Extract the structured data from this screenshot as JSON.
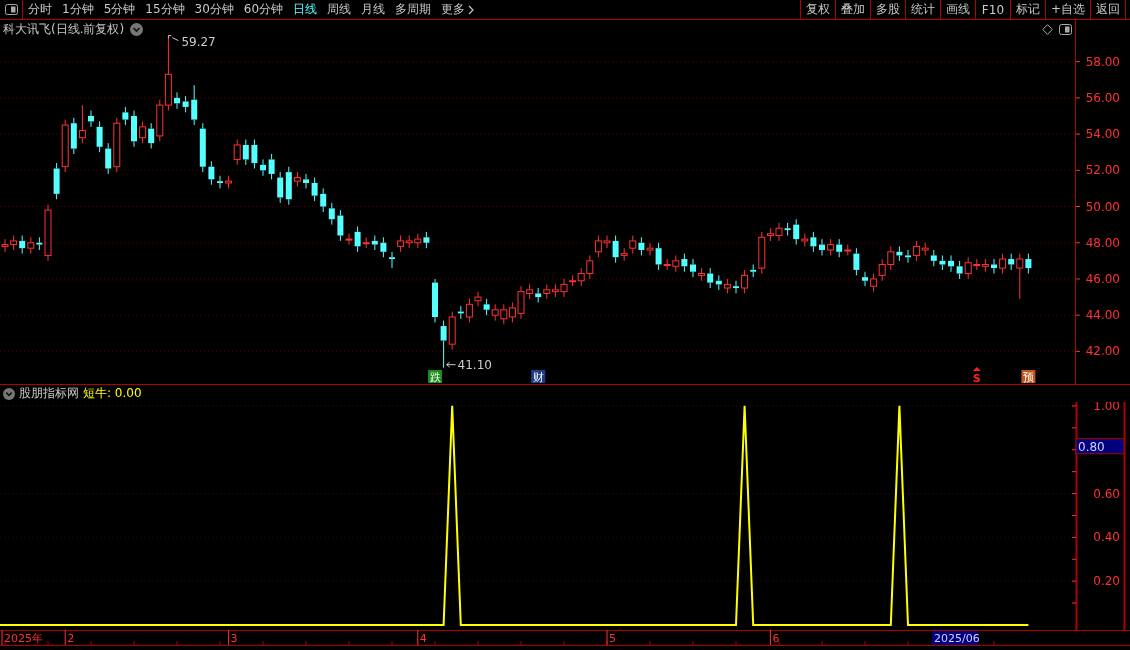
{
  "toolbar": {
    "periods": [
      {
        "label": "分时",
        "selected": false
      },
      {
        "label": "1分钟",
        "selected": false
      },
      {
        "label": "5分钟",
        "selected": false
      },
      {
        "label": "15分钟",
        "selected": false
      },
      {
        "label": "30分钟",
        "selected": false
      },
      {
        "label": "60分钟",
        "selected": false
      },
      {
        "label": "日线",
        "selected": true
      },
      {
        "label": "周线",
        "selected": false
      },
      {
        "label": "月线",
        "selected": false
      },
      {
        "label": "多周期",
        "selected": false
      }
    ],
    "more": "更多",
    "actions": [
      "复权",
      "叠加",
      "多股",
      "统计",
      "画线",
      "F10",
      "标记",
      "+自选",
      "返回"
    ]
  },
  "chart": {
    "title": "科大讯飞(日线.前复权)",
    "chart_data": {
      "type": "candlestick",
      "grid": true,
      "ylim": [
        40.2,
        60.3
      ],
      "yticks": [
        {
          "value": 42,
          "label": "42.00"
        },
        {
          "value": 44,
          "label": "44.00"
        },
        {
          "value": 46,
          "label": "46.00"
        },
        {
          "value": 48,
          "label": "48.00"
        },
        {
          "value": 50,
          "label": "50.00"
        },
        {
          "value": 52,
          "label": "52.00"
        },
        {
          "value": 54,
          "label": "54.00"
        },
        {
          "value": 56,
          "label": "56.00"
        },
        {
          "value": 58,
          "label": "58.00"
        }
      ],
      "ohlc": [
        [
          47.8,
          48.2,
          47.5,
          47.9
        ],
        [
          47.9,
          48.4,
          47.6,
          48.1
        ],
        [
          48.1,
          48.4,
          47.4,
          47.7
        ],
        [
          47.7,
          48.3,
          47.4,
          48.0
        ],
        [
          48.0,
          48.3,
          47.6,
          47.9
        ],
        [
          47.3,
          50.1,
          47.0,
          49.8
        ],
        [
          52.1,
          52.4,
          50.4,
          50.7
        ],
        [
          52.2,
          54.8,
          51.9,
          54.5
        ],
        [
          54.6,
          54.9,
          52.9,
          53.2
        ],
        [
          53.8,
          55.6,
          53.5,
          54.2
        ],
        [
          55.0,
          55.3,
          54.4,
          54.7
        ],
        [
          54.4,
          54.7,
          53.0,
          53.3
        ],
        [
          53.2,
          53.5,
          51.8,
          52.1
        ],
        [
          52.2,
          54.9,
          51.9,
          54.6
        ],
        [
          55.2,
          55.5,
          54.5,
          54.8
        ],
        [
          55.0,
          55.3,
          53.3,
          53.6
        ],
        [
          53.8,
          54.7,
          53.5,
          54.4
        ],
        [
          54.3,
          54.6,
          53.2,
          53.5
        ],
        [
          53.9,
          55.9,
          53.6,
          55.6
        ],
        [
          55.6,
          59.27,
          55.3,
          57.3
        ],
        [
          56.0,
          56.3,
          55.4,
          55.7
        ],
        [
          55.8,
          56.1,
          55.2,
          55.5
        ],
        [
          55.9,
          56.7,
          54.5,
          54.8
        ],
        [
          54.3,
          54.6,
          51.9,
          52.2
        ],
        [
          52.2,
          52.5,
          51.2,
          51.5
        ],
        [
          51.4,
          51.7,
          51.0,
          51.3
        ],
        [
          51.3,
          51.7,
          51.0,
          51.4
        ],
        [
          52.6,
          53.7,
          52.3,
          53.4
        ],
        [
          53.4,
          53.7,
          52.3,
          52.6
        ],
        [
          53.4,
          53.7,
          52.1,
          52.4
        ],
        [
          52.3,
          52.6,
          51.7,
          52.0
        ],
        [
          52.6,
          52.9,
          51.5,
          51.8
        ],
        [
          51.6,
          51.9,
          50.2,
          50.5
        ],
        [
          51.9,
          52.2,
          50.1,
          50.4
        ],
        [
          51.4,
          51.9,
          51.1,
          51.6
        ],
        [
          51.5,
          51.8,
          51.0,
          51.3
        ],
        [
          51.3,
          51.6,
          50.3,
          50.6
        ],
        [
          50.7,
          51.0,
          49.7,
          50.0
        ],
        [
          49.9,
          50.2,
          49.0,
          49.3
        ],
        [
          49.5,
          49.8,
          48.1,
          48.4
        ],
        [
          48.2,
          48.5,
          47.9,
          48.2
        ],
        [
          48.6,
          48.9,
          47.5,
          47.8
        ],
        [
          48.0,
          48.3,
          47.7,
          48.0
        ],
        [
          48.1,
          48.4,
          47.6,
          47.9
        ],
        [
          48.0,
          48.3,
          47.2,
          47.5
        ],
        [
          47.2,
          47.5,
          46.6,
          47.1
        ],
        [
          47.8,
          48.4,
          47.5,
          48.1
        ],
        [
          48.0,
          48.4,
          47.7,
          48.1
        ],
        [
          48.0,
          48.5,
          47.7,
          48.2
        ],
        [
          48.3,
          48.6,
          47.7,
          48.0
        ],
        [
          45.8,
          46.0,
          43.6,
          43.9
        ],
        [
          43.4,
          43.7,
          41.1,
          42.6
        ],
        [
          42.4,
          44.2,
          42.1,
          43.9
        ],
        [
          44.2,
          44.5,
          43.8,
          44.1
        ],
        [
          43.9,
          44.9,
          43.6,
          44.6
        ],
        [
          44.8,
          45.3,
          44.5,
          45.0
        ],
        [
          44.6,
          44.9,
          44.0,
          44.3
        ],
        [
          44.0,
          44.6,
          43.7,
          44.3
        ],
        [
          43.8,
          44.6,
          43.5,
          44.3
        ],
        [
          43.9,
          44.7,
          43.6,
          44.4
        ],
        [
          44.1,
          45.6,
          43.8,
          45.3
        ],
        [
          45.2,
          45.7,
          44.9,
          45.4
        ],
        [
          45.2,
          45.5,
          44.7,
          45.0
        ],
        [
          45.2,
          45.7,
          44.9,
          45.4
        ],
        [
          45.3,
          45.7,
          45.0,
          45.4
        ],
        [
          45.3,
          46.0,
          45.0,
          45.7
        ],
        [
          45.9,
          46.2,
          45.6,
          45.9
        ],
        [
          45.9,
          46.6,
          45.6,
          46.3
        ],
        [
          46.3,
          47.3,
          46.0,
          47.0
        ],
        [
          47.5,
          48.4,
          47.2,
          48.1
        ],
        [
          48.0,
          48.4,
          47.7,
          48.1
        ],
        [
          48.1,
          48.4,
          46.9,
          47.2
        ],
        [
          47.3,
          47.7,
          47.0,
          47.4
        ],
        [
          47.7,
          48.4,
          47.4,
          48.1
        ],
        [
          48.0,
          48.3,
          47.3,
          47.6
        ],
        [
          47.6,
          48.0,
          47.3,
          47.7
        ],
        [
          47.7,
          48.0,
          46.5,
          46.8
        ],
        [
          46.8,
          47.1,
          46.5,
          46.8
        ],
        [
          46.7,
          47.3,
          46.4,
          47.0
        ],
        [
          47.1,
          47.4,
          46.4,
          46.7
        ],
        [
          46.8,
          47.1,
          46.1,
          46.4
        ],
        [
          46.2,
          46.6,
          45.9,
          46.3
        ],
        [
          46.3,
          46.6,
          45.5,
          45.8
        ],
        [
          45.9,
          46.2,
          45.4,
          45.7
        ],
        [
          45.5,
          46.0,
          45.2,
          45.7
        ],
        [
          45.6,
          45.9,
          45.2,
          45.5
        ],
        [
          45.5,
          46.5,
          45.2,
          46.2
        ],
        [
          46.5,
          46.8,
          46.1,
          46.4
        ],
        [
          46.6,
          48.6,
          46.3,
          48.3
        ],
        [
          48.4,
          48.8,
          48.1,
          48.5
        ],
        [
          48.4,
          49.1,
          48.1,
          48.8
        ],
        [
          48.8,
          49.1,
          48.4,
          48.7
        ],
        [
          49.0,
          49.3,
          47.9,
          48.2
        ],
        [
          48.1,
          48.5,
          47.8,
          48.2
        ],
        [
          48.3,
          48.6,
          47.5,
          47.8
        ],
        [
          47.9,
          48.2,
          47.3,
          47.6
        ],
        [
          47.6,
          48.2,
          47.3,
          47.9
        ],
        [
          47.9,
          48.2,
          47.2,
          47.5
        ],
        [
          47.6,
          47.9,
          47.3,
          47.6
        ],
        [
          47.4,
          47.7,
          46.2,
          46.5
        ],
        [
          46.1,
          46.4,
          45.6,
          45.9
        ],
        [
          45.6,
          46.3,
          45.3,
          46.0
        ],
        [
          46.2,
          47.1,
          45.9,
          46.8
        ],
        [
          46.8,
          47.8,
          46.5,
          47.5
        ],
        [
          47.5,
          47.8,
          47.0,
          47.3
        ],
        [
          47.3,
          47.6,
          46.9,
          47.2
        ],
        [
          47.3,
          48.1,
          47.0,
          47.8
        ],
        [
          47.6,
          48.0,
          47.3,
          47.7
        ],
        [
          47.3,
          47.6,
          46.7,
          47.0
        ],
        [
          47.0,
          47.3,
          46.5,
          46.8
        ],
        [
          47.0,
          47.3,
          46.4,
          46.7
        ],
        [
          46.7,
          47.0,
          46.0,
          46.3
        ],
        [
          46.3,
          47.2,
          46.0,
          46.9
        ],
        [
          46.8,
          47.1,
          46.5,
          46.8
        ],
        [
          46.7,
          47.1,
          46.4,
          46.8
        ],
        [
          46.8,
          47.1,
          46.3,
          46.6
        ],
        [
          46.6,
          47.4,
          46.3,
          47.1
        ],
        [
          47.1,
          47.4,
          46.5,
          46.8
        ],
        [
          46.6,
          47.4,
          44.9,
          47.1
        ],
        [
          47.1,
          47.4,
          46.3,
          46.6
        ]
      ],
      "annotations": [
        {
          "text": "59.27"
        },
        {
          "text": "41.10"
        }
      ]
    },
    "signals": [
      {
        "kind": "tag",
        "text": "跌",
        "color": "#1c8c1c"
      },
      {
        "kind": "tag",
        "text": "财",
        "color": "#1d3f8a"
      },
      {
        "kind": "sell",
        "text": "S",
        "color": "#ff2020"
      },
      {
        "kind": "tag",
        "text": "预",
        "color": "#c0561a"
      }
    ]
  },
  "indicator": {
    "name": "股朋指标网",
    "reading": ": 0.00",
    "cursor_value": "0.80",
    "cursor_date": "2025/06",
    "date_labels": [
      "2025年",
      "2",
      "3",
      "4",
      "5",
      "6"
    ],
    "chart_data": {
      "type": "line",
      "grid": true,
      "ylim": [
        -0.023,
        1.018
      ],
      "yticks": [
        {
          "value": 0.2,
          "label": "0.20"
        },
        {
          "value": 0.4,
          "label": "0.40"
        },
        {
          "value": 0.6,
          "label": "0.60"
        },
        {
          "value": 1.0,
          "label": "1.00"
        }
      ],
      "series": [
        {
          "name": "短牛",
          "color": "#ffff00",
          "values": [
            0,
            0,
            0,
            0,
            0,
            0,
            0,
            0,
            0,
            0,
            0,
            0,
            0,
            0,
            0,
            0,
            0,
            0,
            0,
            0,
            0,
            0,
            0,
            0,
            0,
            0,
            0,
            0,
            0,
            0,
            0,
            0,
            0,
            0,
            0,
            0,
            0,
            0,
            0,
            0,
            0,
            0,
            0,
            0,
            0,
            0,
            0,
            0,
            0,
            0,
            0,
            0,
            1,
            0,
            0,
            0,
            0,
            0,
            0,
            0,
            0,
            0,
            0,
            0,
            0,
            0,
            0,
            0,
            0,
            0,
            0,
            0,
            0,
            0,
            0,
            0,
            0,
            0,
            0,
            0,
            0,
            0,
            0,
            0,
            0,
            0,
            1,
            0,
            0,
            0,
            0,
            0,
            0,
            0,
            0,
            0,
            0,
            0,
            0,
            0,
            0,
            0,
            0,
            0,
            1,
            0,
            0,
            0,
            0,
            0,
            0,
            0,
            0,
            0,
            0,
            0,
            0,
            0,
            0,
            0
          ]
        }
      ]
    }
  }
}
